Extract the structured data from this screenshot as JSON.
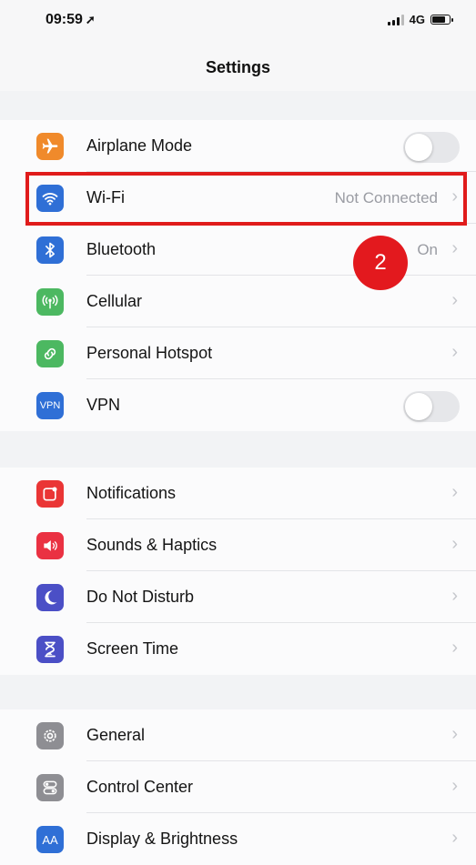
{
  "status_bar": {
    "time": "09:59",
    "location_arrow": "➚",
    "network": "4G"
  },
  "nav": {
    "title": "Settings"
  },
  "colors": {
    "airplane": "#f08a2b",
    "wifi": "#2f6fd6",
    "bluetooth": "#2f6fd6",
    "cellular": "#4cb861",
    "hotspot": "#4cb861",
    "vpn": "#2f6fd6",
    "notifications": "#ea3535",
    "sounds": "#ea3142",
    "dnd": "#4b4fc6",
    "screen_time": "#4b4fc6",
    "general": "#8e8e93",
    "control_center": "#8e8e93",
    "display": "#2f6fd6",
    "highlight": "#e01b1b"
  },
  "group1": {
    "airplane": {
      "label": "Airplane Mode",
      "icon": "airplane-icon",
      "toggle_on": false
    },
    "wifi": {
      "label": "Wi-Fi",
      "icon": "wifi-icon",
      "value": "Not Connected"
    },
    "bluetooth": {
      "label": "Bluetooth",
      "icon": "bluetooth-icon",
      "value": "On"
    },
    "cellular": {
      "label": "Cellular",
      "icon": "antenna-icon"
    },
    "hotspot": {
      "label": "Personal Hotspot",
      "icon": "link-icon"
    },
    "vpn": {
      "label": "VPN",
      "icon": "vpn-icon",
      "icon_text": "VPN",
      "toggle_on": false
    }
  },
  "group2": {
    "notifications": {
      "label": "Notifications",
      "icon": "notifications-icon"
    },
    "sounds": {
      "label": "Sounds & Haptics",
      "icon": "speaker-icon"
    },
    "dnd": {
      "label": "Do Not Disturb",
      "icon": "moon-icon"
    },
    "screen_time": {
      "label": "Screen Time",
      "icon": "hourglass-icon"
    }
  },
  "group3": {
    "general": {
      "label": "General",
      "icon": "gear-icon"
    },
    "control_center": {
      "label": "Control Center",
      "icon": "toggles-icon"
    },
    "display": {
      "label": "Display & Brightness",
      "icon": "text-size-icon",
      "icon_text": "AA"
    }
  },
  "annotation": {
    "step": "2"
  },
  "chevron": "›"
}
